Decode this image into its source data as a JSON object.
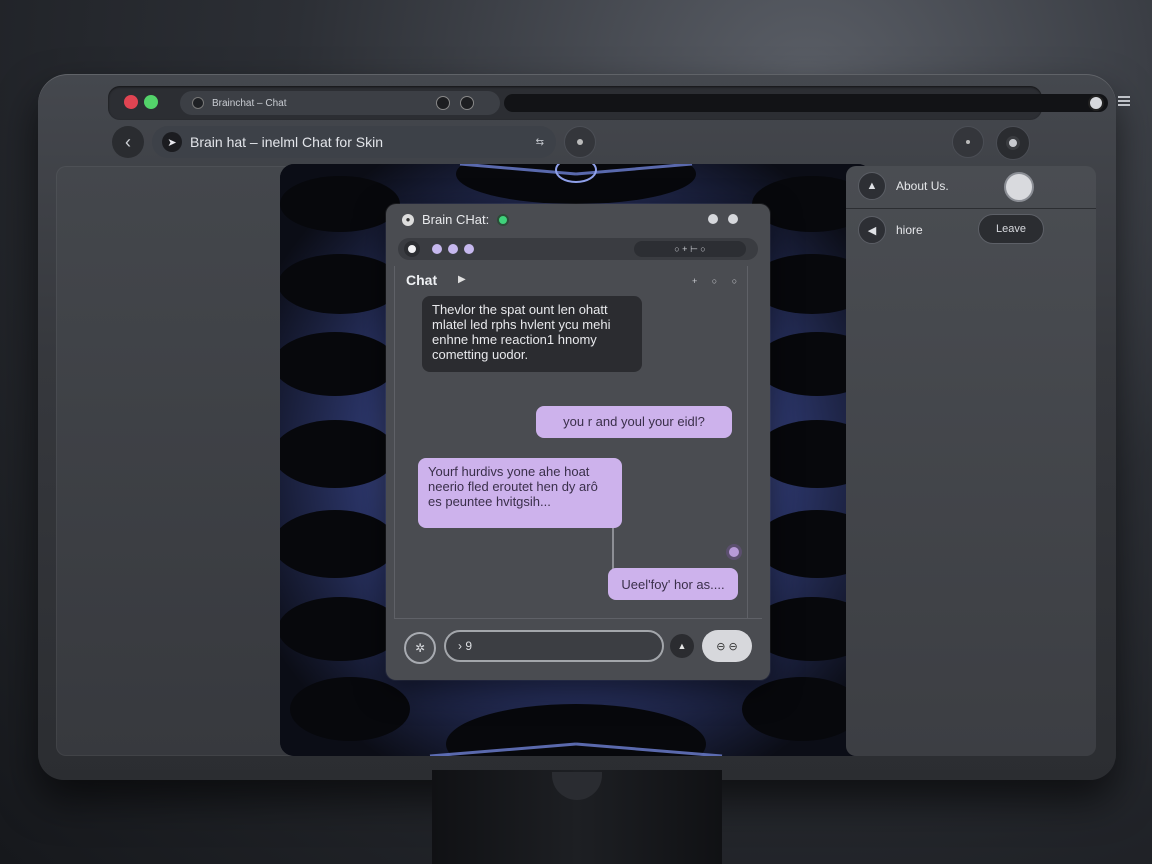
{
  "browser": {
    "tab_title": "Brainchat – Chat",
    "address": "Brain hat – inelml Chat for Skin",
    "address_share_icon": "⇆"
  },
  "right_panel": {
    "about_label": "About Us.",
    "more_label": "hiore",
    "leave_label": "Leave"
  },
  "chat": {
    "title": "Brain CHat:",
    "section_label": "Chat",
    "toolbar_icons": "○  +  ⊢  ○",
    "head_icons": "+ ○ ○",
    "messages": [
      {
        "from": "bot",
        "text": "Thevlor the spat ount len ohatt mlatel led rphs hvlent ycu mehi enhne hme reaction1 hnomy cometting uodor."
      },
      {
        "from": "user",
        "text": "you r and youl your eidl?"
      },
      {
        "from": "user",
        "text": "Yourf hurdivs yone ahe hoat neerio fled eroutet hen dy arô es peuntee hvitgsih..."
      },
      {
        "from": "user",
        "text": "Ueel'foy' hor as...."
      }
    ],
    "input_value": "› 9",
    "attach_label": "✲",
    "send_label": "⊖ ⊖"
  },
  "colors": {
    "accent_lavender": "#cdb2ec",
    "status_green": "#3fd27b",
    "traffic_red": "#e04452",
    "traffic_green": "#53d36a"
  }
}
